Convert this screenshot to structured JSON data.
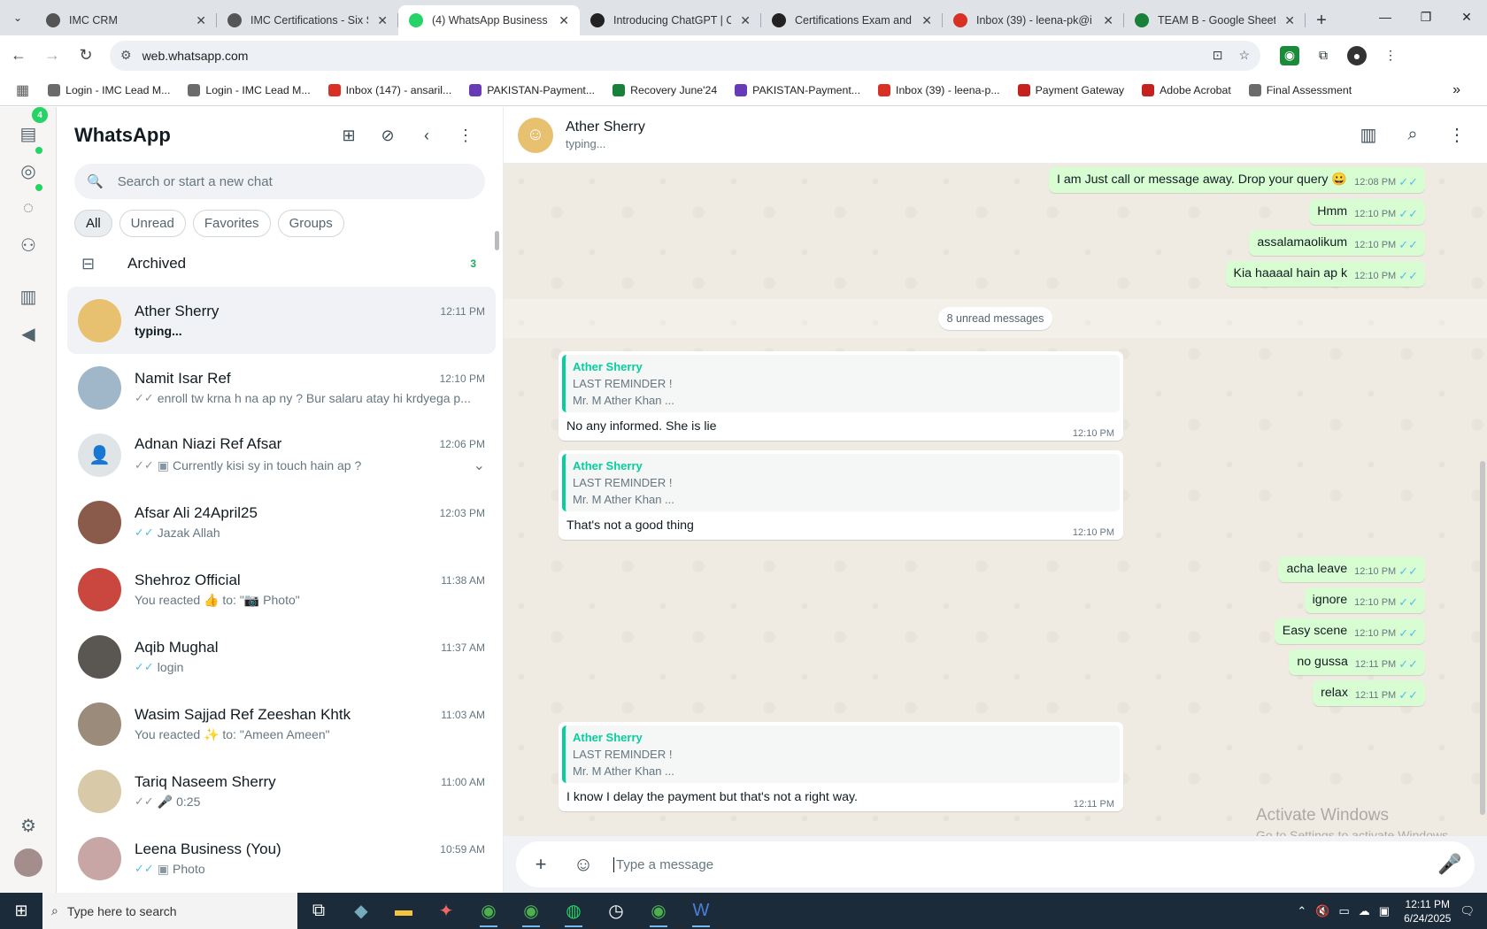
{
  "browser": {
    "tabs": [
      {
        "title": "IMC CRM",
        "fav_color": "#555555",
        "active": false
      },
      {
        "title": "IMC Certifications - Six S",
        "fav_color": "#555555",
        "active": false
      },
      {
        "title": "(4) WhatsApp Business",
        "fav_color": "#25d366",
        "active": true
      },
      {
        "title": "Introducing ChatGPT | O",
        "fav_color": "#222222",
        "active": false
      },
      {
        "title": "Certifications Exam and",
        "fav_color": "#222222",
        "active": false
      },
      {
        "title": "Inbox (39) - leena-pk@i",
        "fav_color": "#d93025",
        "active": false
      },
      {
        "title": "TEAM B - Google Sheets",
        "fav_color": "#188038",
        "active": false
      }
    ],
    "url": "web.whatsapp.com",
    "bookmarks": [
      {
        "label": "Login - IMC Lead M...",
        "color": "#6b6b6b"
      },
      {
        "label": "Login - IMC Lead M...",
        "color": "#6b6b6b"
      },
      {
        "label": "Inbox (147) - ansaril...",
        "color": "#d93025"
      },
      {
        "label": "PAKISTAN-Payment...",
        "color": "#673ab7"
      },
      {
        "label": "Recovery June'24",
        "color": "#188038"
      },
      {
        "label": "PAKISTAN-Payment...",
        "color": "#673ab7"
      },
      {
        "label": "Inbox (39) - leena-p...",
        "color": "#d93025"
      },
      {
        "label": "Payment Gateway",
        "color": "#c5221f"
      },
      {
        "label": "Adobe Acrobat",
        "color": "#c5221f"
      },
      {
        "label": "Final Assessment",
        "color": "#6b6b6b"
      }
    ]
  },
  "rail": {
    "badge_count": "4"
  },
  "sidebar": {
    "title": "WhatsApp",
    "search_placeholder": "Search or start a new chat",
    "filters": [
      "All",
      "Unread",
      "Favorites",
      "Groups"
    ],
    "archived_label": "Archived",
    "archived_count": "3",
    "chats": [
      {
        "name": "Ather Sherry",
        "time": "12:11 PM",
        "preview": "typing...",
        "tick": "",
        "avatar_color": "#e7c170",
        "selected": true,
        "bold": true
      },
      {
        "name": "Namit Isar Ref",
        "time": "12:10 PM",
        "preview": "enroll tw krna h na ap ny ? Bur salaru atay hi krdyega p...",
        "tick": "gray",
        "avatar_color": "#9fb7c9",
        "selected": false,
        "bold": false
      },
      {
        "name": "Adnan Niazi Ref Afsar",
        "time": "12:06 PM",
        "preview": "Currently kisi sy in touch hain ap ?",
        "tick": "gray",
        "photo": true,
        "avatar_color": "#dfe5e7",
        "selected": false,
        "bold": false
      },
      {
        "name": "Afsar Ali 24April25",
        "time": "12:03 PM",
        "preview": "Jazak Allah",
        "tick": "blue",
        "avatar_color": "#8a5a4a",
        "selected": false,
        "bold": false
      },
      {
        "name": "Shehroz Official",
        "time": "11:38 AM",
        "preview": "You reacted 👍 to: \"📷 Photo\"",
        "tick": "",
        "avatar_color": "#c9473f",
        "selected": false,
        "bold": false
      },
      {
        "name": "Aqib Mughal",
        "time": "11:37 AM",
        "preview": "login",
        "tick": "blue",
        "avatar_color": "#5a5652",
        "selected": false,
        "bold": false
      },
      {
        "name": "Wasim Sajjad Ref Zeeshan Khtk",
        "time": "11:03 AM",
        "preview": "You reacted ✨ to: \"Ameen Ameen\"",
        "tick": "",
        "avatar_color": "#9a8b7a",
        "selected": false,
        "bold": false
      },
      {
        "name": "Tariq Naseem Sherry",
        "time": "11:00 AM",
        "preview": "🎤 0:25",
        "tick": "gray",
        "avatar_color": "#d8c9a8",
        "selected": false,
        "bold": false
      },
      {
        "name": "Leena Business (You)",
        "time": "10:59 AM",
        "preview": "Photo",
        "tick": "blue",
        "photo": true,
        "avatar_color": "#c9a6a6",
        "selected": false,
        "bold": false
      }
    ]
  },
  "conversation": {
    "name": "Ather Sherry",
    "status": "typing...",
    "unread_label": "8 unread messages",
    "outgoing_top": [
      {
        "text": "I am Just call or message away. Drop your query 😀",
        "time": "12:08 PM"
      },
      {
        "text": "Hmm",
        "time": "12:10 PM"
      },
      {
        "text": "assalamaolikum",
        "time": "12:10 PM"
      },
      {
        "text": "Kia haaaal hain ap k",
        "time": "12:10 PM"
      }
    ],
    "incoming": [
      {
        "quote_name": "Ather Sherry",
        "quote_line1": "LAST REMINDER !",
        "quote_line2": "Mr. M Ather Khan    ...",
        "text": "No any informed. She is lie",
        "time": "12:10 PM"
      },
      {
        "quote_name": "Ather Sherry",
        "quote_line1": "LAST REMINDER !",
        "quote_line2": "Mr. M Ather Khan    ...",
        "text": "That's not a good thing",
        "time": "12:10 PM"
      },
      {
        "quote_name": "Ather Sherry",
        "quote_line1": "LAST REMINDER !",
        "quote_line2": "Mr. M Ather Khan    ...",
        "text": "I know I delay the payment but that's not a right way.",
        "time": "12:11 PM"
      }
    ],
    "outgoing_mid": [
      {
        "text": "acha leave",
        "time": "12:10 PM"
      },
      {
        "text": "ignore",
        "time": "12:10 PM"
      },
      {
        "text": "Easy scene",
        "time": "12:10 PM"
      },
      {
        "text": "no gussa",
        "time": "12:11 PM"
      },
      {
        "text": "relax",
        "time": "12:11 PM"
      }
    ],
    "composer_placeholder": "Type a message"
  },
  "watermark": {
    "line1": "Activate Windows",
    "line2": "Go to Settings to activate Windows."
  },
  "taskbar": {
    "search_placeholder": "Type here to search",
    "time": "12:11 PM",
    "date": "6/24/2025"
  }
}
